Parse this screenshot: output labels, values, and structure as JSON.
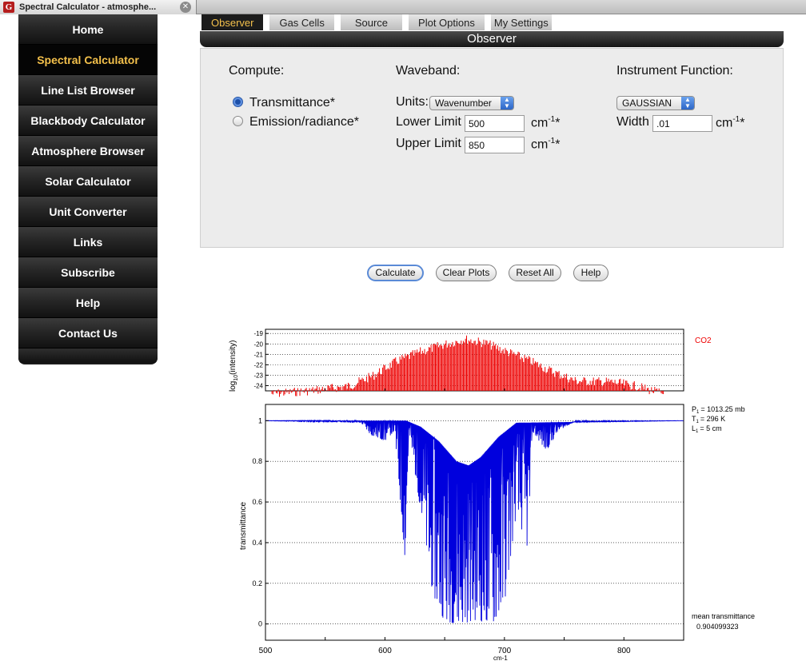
{
  "browser": {
    "tab_title": "Spectral Calculator - atmosphe...",
    "favicon_letter": "G",
    "close_glyph": "✕"
  },
  "sidebar": {
    "items": [
      {
        "label": "Home",
        "active": false
      },
      {
        "label": "Spectral Calculator",
        "active": true
      },
      {
        "label": "Line List Browser",
        "active": false
      },
      {
        "label": "Blackbody Calculator",
        "active": false
      },
      {
        "label": "Atmosphere Browser",
        "active": false
      },
      {
        "label": "Solar Calculator",
        "active": false
      },
      {
        "label": "Unit Converter",
        "active": false
      },
      {
        "label": "Links",
        "active": false
      },
      {
        "label": "Subscribe",
        "active": false
      },
      {
        "label": "Help",
        "active": false
      },
      {
        "label": "Contact Us",
        "active": false
      }
    ]
  },
  "calc_tabs": [
    {
      "label": "Observer",
      "active": true
    },
    {
      "label": "Gas Cells",
      "active": false
    },
    {
      "label": "Source",
      "active": false
    },
    {
      "label": "Plot Options",
      "active": false
    },
    {
      "label": "My Settings",
      "active": false
    }
  ],
  "panel": {
    "title": "Observer",
    "compute": {
      "heading": "Compute:",
      "options": [
        {
          "label": "Transmittance*",
          "selected": true
        },
        {
          "label": "Emission/radiance*",
          "selected": false
        }
      ]
    },
    "waveband": {
      "heading": "Waveband:",
      "units_label": "Units:",
      "units_value": "Wavenumber",
      "lower_label": "Lower Limit",
      "lower_value": "500",
      "upper_label": "Upper Limit",
      "upper_value": "850",
      "unit_base": "cm",
      "unit_exp": "-1",
      "unit_star": "*"
    },
    "instrument": {
      "heading": "Instrument Function:",
      "function_value": "GAUSSIAN",
      "width_label": "Width",
      "width_value": ".01",
      "unit_base": "cm",
      "unit_exp": "-1",
      "unit_star": "*"
    }
  },
  "actions": {
    "calculate": "Calculate",
    "clear": "Clear Plots",
    "reset": "Reset All",
    "help": "Help"
  },
  "colors": {
    "accent": "#f3c04b",
    "line_intensity": "#ee0000",
    "transmittance": "#0000dd"
  },
  "chart_data": [
    {
      "type": "bar",
      "ylabel": "log10(intensity)",
      "ylabel_main": "log",
      "ylabel_sub": "10",
      "ylabel_rest": "(intensity)",
      "legend": "CO2",
      "yticks": [
        "-19",
        "-20",
        "-21",
        "-22",
        "-23",
        "-24"
      ],
      "ylim": [
        -24.5,
        -18.6
      ],
      "xlim": [
        500,
        850
      ],
      "envelope": [
        {
          "x": 500,
          "y": -24.4
        },
        {
          "x": 540,
          "y": -24.0
        },
        {
          "x": 570,
          "y": -23.6
        },
        {
          "x": 590,
          "y": -22.6
        },
        {
          "x": 610,
          "y": -21.2
        },
        {
          "x": 630,
          "y": -20.3
        },
        {
          "x": 650,
          "y": -19.6
        },
        {
          "x": 667,
          "y": -19.1
        },
        {
          "x": 685,
          "y": -19.5
        },
        {
          "x": 700,
          "y": -20.2
        },
        {
          "x": 720,
          "y": -21.1
        },
        {
          "x": 740,
          "y": -22.2
        },
        {
          "x": 760,
          "y": -23.1
        },
        {
          "x": 790,
          "y": -23.2
        },
        {
          "x": 810,
          "y": -23.6
        },
        {
          "x": 835,
          "y": -24.4
        }
      ]
    },
    {
      "type": "line",
      "ylabel": "transmittance",
      "xlabel": "cm-1",
      "xticks": [
        500,
        600,
        700,
        800
      ],
      "yticks": [
        0,
        0.2,
        0.4,
        0.6,
        0.8,
        1
      ],
      "xlim": [
        500,
        850
      ],
      "ylim": [
        -0.08,
        1.08
      ],
      "annotations": {
        "p_label": "P",
        "p_value": "= 1013.25 mb",
        "t_label": "T",
        "t_value": "= 296 K",
        "l_label": "L",
        "l_value": "= 5 cm",
        "sub": "1",
        "mean_label": "mean transmittance",
        "mean_value": "0.904099323"
      },
      "series": [
        {
          "envelope_min": [
            {
              "x": 500,
              "y": 1.0
            },
            {
              "x": 580,
              "y": 0.99
            },
            {
              "x": 588,
              "y": 0.93
            },
            {
              "x": 600,
              "y": 0.9
            },
            {
              "x": 608,
              "y": 0.95
            },
            {
              "x": 617,
              "y": 0.3
            },
            {
              "x": 620,
              "y": 0.95
            },
            {
              "x": 630,
              "y": 0.55
            },
            {
              "x": 640,
              "y": 0.15
            },
            {
              "x": 650,
              "y": 0.01
            },
            {
              "x": 665,
              "y": 0.0
            },
            {
              "x": 675,
              "y": 0.02
            },
            {
              "x": 690,
              "y": 0.0
            },
            {
              "x": 700,
              "y": 0.1
            },
            {
              "x": 710,
              "y": 0.55
            },
            {
              "x": 720,
              "y": 0.36
            },
            {
              "x": 723,
              "y": 0.95
            },
            {
              "x": 735,
              "y": 0.85
            },
            {
              "x": 745,
              "y": 0.95
            },
            {
              "x": 760,
              "y": 1.0
            },
            {
              "x": 850,
              "y": 1.0
            }
          ],
          "envelope_max": [
            {
              "x": 500,
              "y": 1.0
            },
            {
              "x": 618,
              "y": 1.0
            },
            {
              "x": 630,
              "y": 0.97
            },
            {
              "x": 645,
              "y": 0.9
            },
            {
              "x": 660,
              "y": 0.8
            },
            {
              "x": 670,
              "y": 0.78
            },
            {
              "x": 680,
              "y": 0.82
            },
            {
              "x": 695,
              "y": 0.92
            },
            {
              "x": 710,
              "y": 0.99
            },
            {
              "x": 850,
              "y": 1.0
            }
          ]
        }
      ]
    }
  ]
}
